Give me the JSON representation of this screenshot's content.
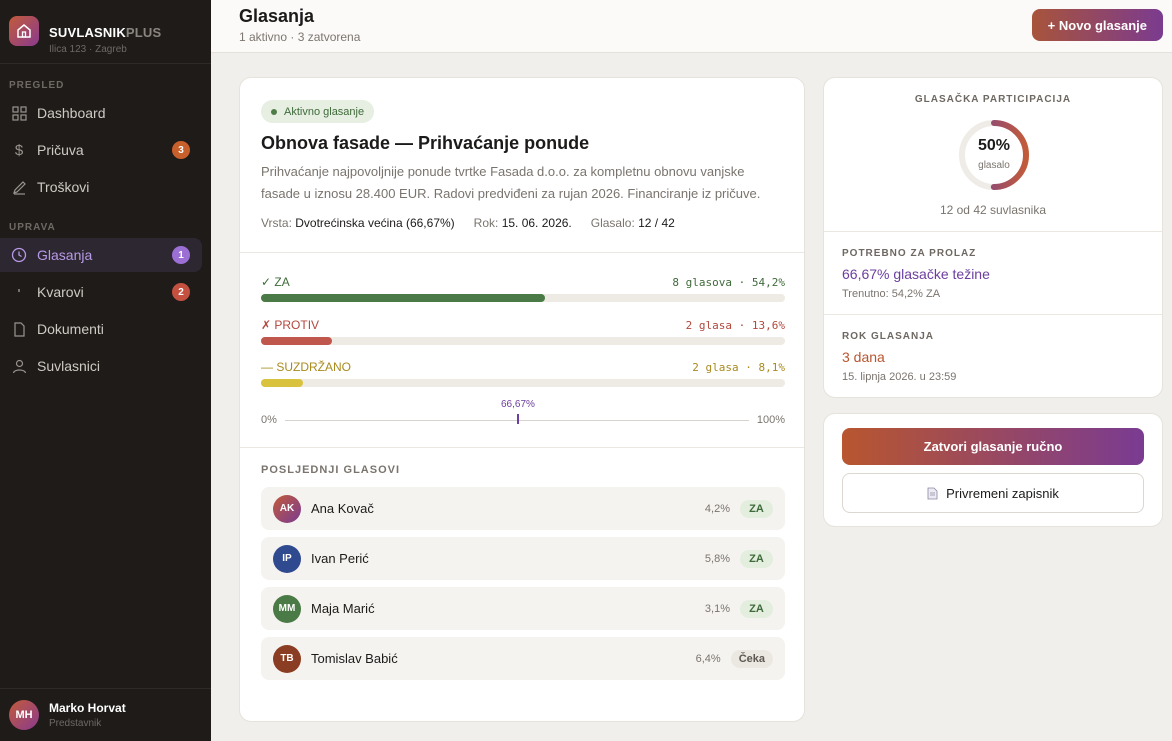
{
  "brand": {
    "name_main": "SUVLASNIK",
    "name_suffix": "PLUS",
    "address": "Ilica 123 · Zagreb"
  },
  "sidebar": {
    "sections": [
      "PREGLED",
      "UPRAVA"
    ],
    "items": [
      {
        "label": "Dashboard",
        "icon": "grid-icon"
      },
      {
        "label": "Pričuva",
        "icon": "dollar-icon",
        "count": "3"
      },
      {
        "label": "Troškovi",
        "icon": "pen-icon"
      },
      {
        "label": "Glasanja",
        "icon": "clock-icon",
        "count": "1",
        "active": true
      },
      {
        "label": "Kvarovi",
        "icon": "dot-icon",
        "count": "2"
      },
      {
        "label": "Dokumenti",
        "icon": "document-icon"
      },
      {
        "label": "Suvlasnici",
        "icon": "user-icon"
      }
    ]
  },
  "user": {
    "initials": "MH",
    "name": "Marko Horvat",
    "role": "Predstavnik"
  },
  "header": {
    "title": "Glasanja",
    "subtitle": "1 aktivno · 3 zatvorena",
    "new_button": "+ Novo glasanje"
  },
  "vote": {
    "status": "Aktivno glasanje",
    "title": "Obnova fasade — Prihvaćanje ponude",
    "description": "Prihvaćanje najpovoljnije ponude tvrtke Fasada d.o.o. za kompletnu obnovu vanjske fasade u iznosu 28.400 EUR. Radovi predviđeni za rujan 2026. Financiranje iz pričuve.",
    "meta": [
      {
        "label": "Vrsta:",
        "value": "Dvotrećinska većina (66,67%)"
      },
      {
        "label": "Rok:",
        "value": "15. 06. 2026."
      },
      {
        "label": "Glasalo:",
        "value": "12 / 42"
      }
    ],
    "results": [
      {
        "label": "✓ ZA",
        "value": "8 glasova · 54,2%",
        "pct": 54.2,
        "color": "#4a7a45"
      },
      {
        "label": "✗ PROTIV",
        "value": "2 glasa · 13,6%",
        "pct": 13.6,
        "color": "#c0574d"
      },
      {
        "label": "— SUZDRŽANO",
        "value": "2 glasa · 8,1%",
        "pct": 8.1,
        "color": "#d9c23d"
      }
    ],
    "scale": {
      "min": "0%",
      "max": "100%",
      "threshold": "66,67%"
    },
    "recent_title": "POSLJEDNJI GLASOVI",
    "recent": [
      {
        "initials": "AK",
        "name": "Ana Kovač",
        "share": "4,2%",
        "vote": "ZA",
        "avatar_bg": "linear-gradient(135deg,#c25b3a,#7a3b92)"
      },
      {
        "initials": "IP",
        "name": "Ivan Perić",
        "share": "5,8%",
        "vote": "ZA",
        "avatar_bg": "#2f4a8f"
      },
      {
        "initials": "MM",
        "name": "Maja Marić",
        "share": "3,1%",
        "vote": "ZA",
        "avatar_bg": "#4a7a45"
      },
      {
        "initials": "TB",
        "name": "Tomislav Babić",
        "share": "6,4%",
        "vote": "Čeka",
        "avatar_bg": "#8a3d22"
      }
    ]
  },
  "participation": {
    "label": "GLASAČKA PARTICIPACIJA",
    "pct": "50%",
    "pct_value": 50,
    "donut_label": "glasalo",
    "caption": "12 od 42 suvlasnika"
  },
  "pass": {
    "label": "POTREBNO ZA PROLAZ",
    "value": "66,67% glasačke težine",
    "current": "Trenutno: 54,2% ZA"
  },
  "deadline": {
    "label": "ROK GLASANJA",
    "value": "3 dana",
    "date": "15. lipnja 2026. u 23:59"
  },
  "actions": {
    "close": "Zatvori glasanje ručno",
    "minutes": "Privremeni zapisnik"
  }
}
